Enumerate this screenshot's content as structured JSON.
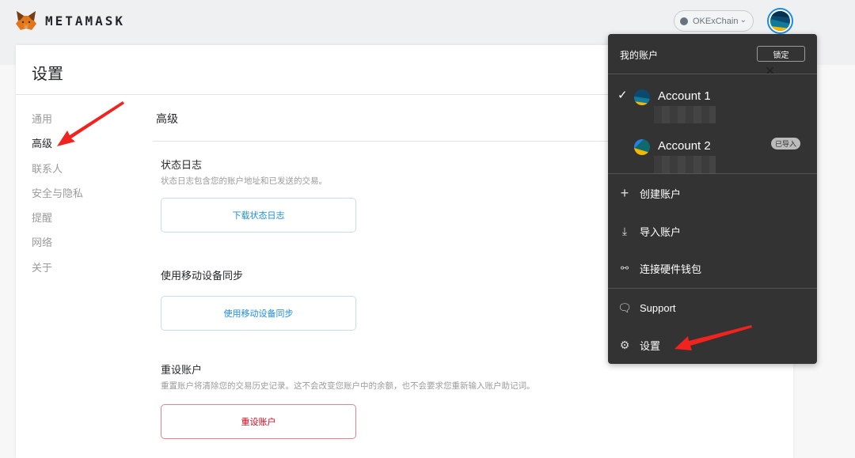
{
  "app": {
    "brand": "METAMASK",
    "network": "OKExChain"
  },
  "settings": {
    "title": "设置",
    "sidebar": [
      {
        "label": "通用",
        "active": false
      },
      {
        "label": "高级",
        "active": true
      },
      {
        "label": "联系人",
        "active": false
      },
      {
        "label": "安全与隐私",
        "active": false
      },
      {
        "label": "提醒",
        "active": false
      },
      {
        "label": "网络",
        "active": false
      },
      {
        "label": "关于",
        "active": false
      }
    ],
    "section_title": "高级",
    "blocks": [
      {
        "title": "状态日志",
        "desc": "状态日志包含您的账户地址和已发送的交易。",
        "button": "下载状态日志"
      },
      {
        "title": "使用移动设备同步",
        "desc": "",
        "button": "使用移动设备同步"
      },
      {
        "title": "重设账户",
        "desc": "重置账户将清除您的交易历史记录。这不会改变您账户中的余额，也不会要求您重新输入账户助记词。",
        "button": "重设账户"
      }
    ]
  },
  "account_menu": {
    "header": "我的账户",
    "lock_label": "锁定",
    "accounts": [
      {
        "name": "Account 1",
        "selected": true,
        "badge": ""
      },
      {
        "name": "Account 2",
        "selected": false,
        "badge": "已导入"
      }
    ],
    "actions": [
      {
        "label": "创建账户",
        "icon": "plus-icon"
      },
      {
        "label": "导入账户",
        "icon": "download-icon"
      },
      {
        "label": "连接硬件钱包",
        "icon": "usb-icon"
      }
    ],
    "footer": [
      {
        "label": "Support",
        "icon": "chat-icon"
      },
      {
        "label": "设置",
        "icon": "gear-icon"
      }
    ]
  },
  "colors": {
    "accent": "#1c8ce0",
    "danger": "#d0021b",
    "menu_bg": "#333333",
    "annotation_arrow": "#f2231f"
  }
}
